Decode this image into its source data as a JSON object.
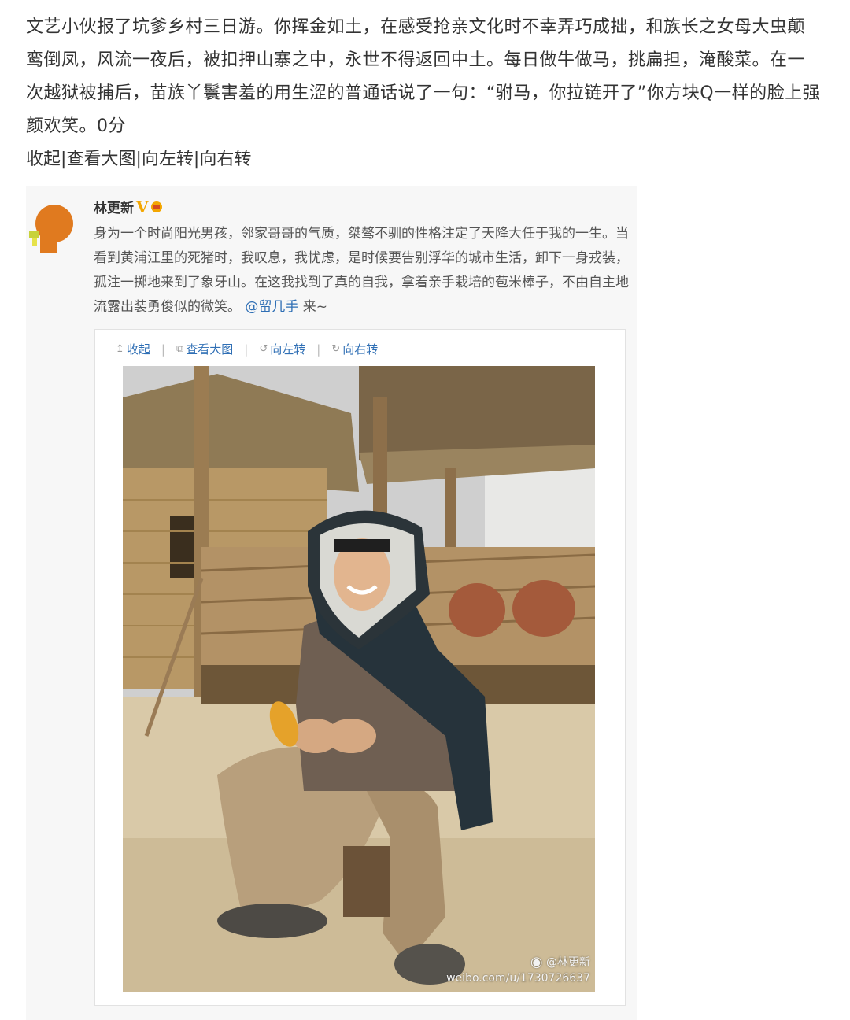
{
  "repost": {
    "text": "文艺小伙报了坑爹乡村三日游。你挥金如土，在感受抢亲文化时不幸弄巧成拙，和族长之女母大虫颠鸾倒凤，风流一夜后，被扣押山寨之中，永世不得返回中土。每日做牛做马，挑扁担，淹酸菜。在一次越狱被捕后，苗族丫鬟害羞的用生涩的普通话说了一句：“驸马，你拉链开了”你方块Q一样的脸上强颜欢笑。0分",
    "actions": [
      "收起",
      "查看大图",
      "向左转",
      "向右转"
    ],
    "separator": "|"
  },
  "original": {
    "username": "林更新",
    "verified_badge": "V",
    "post_text": "身为一个时尚阳光男孩，邻家哥哥的气质，桀骜不驯的性格注定了天降大任于我的一生。当看到黄浦江里的死猪时，我叹息，我忧虑，是时候要告别浮华的城市生活，卸下一身戎装，孤注一掷地来到了象牙山。在这我找到了真的自我，拿着亲手栽培的苞米棒子，不由自主地流露出装勇俊似的微笑。",
    "mention": "@留几手",
    "post_suffix": " 来~",
    "media_toolbar": {
      "collapse": "收起",
      "view_large": "查看大图",
      "rotate_left": "向左转",
      "rotate_right": "向右转",
      "icons": [
        "arrow-up-icon",
        "external-link-icon",
        "rotate-left-icon",
        "rotate-right-icon"
      ]
    },
    "watermark_user": "@林更新",
    "watermark_url": "weibo.com/u/1730726637"
  },
  "colors": {
    "link": "#2f6fb5",
    "badge": "#f3a600",
    "card_bg": "#f7f7f7"
  }
}
